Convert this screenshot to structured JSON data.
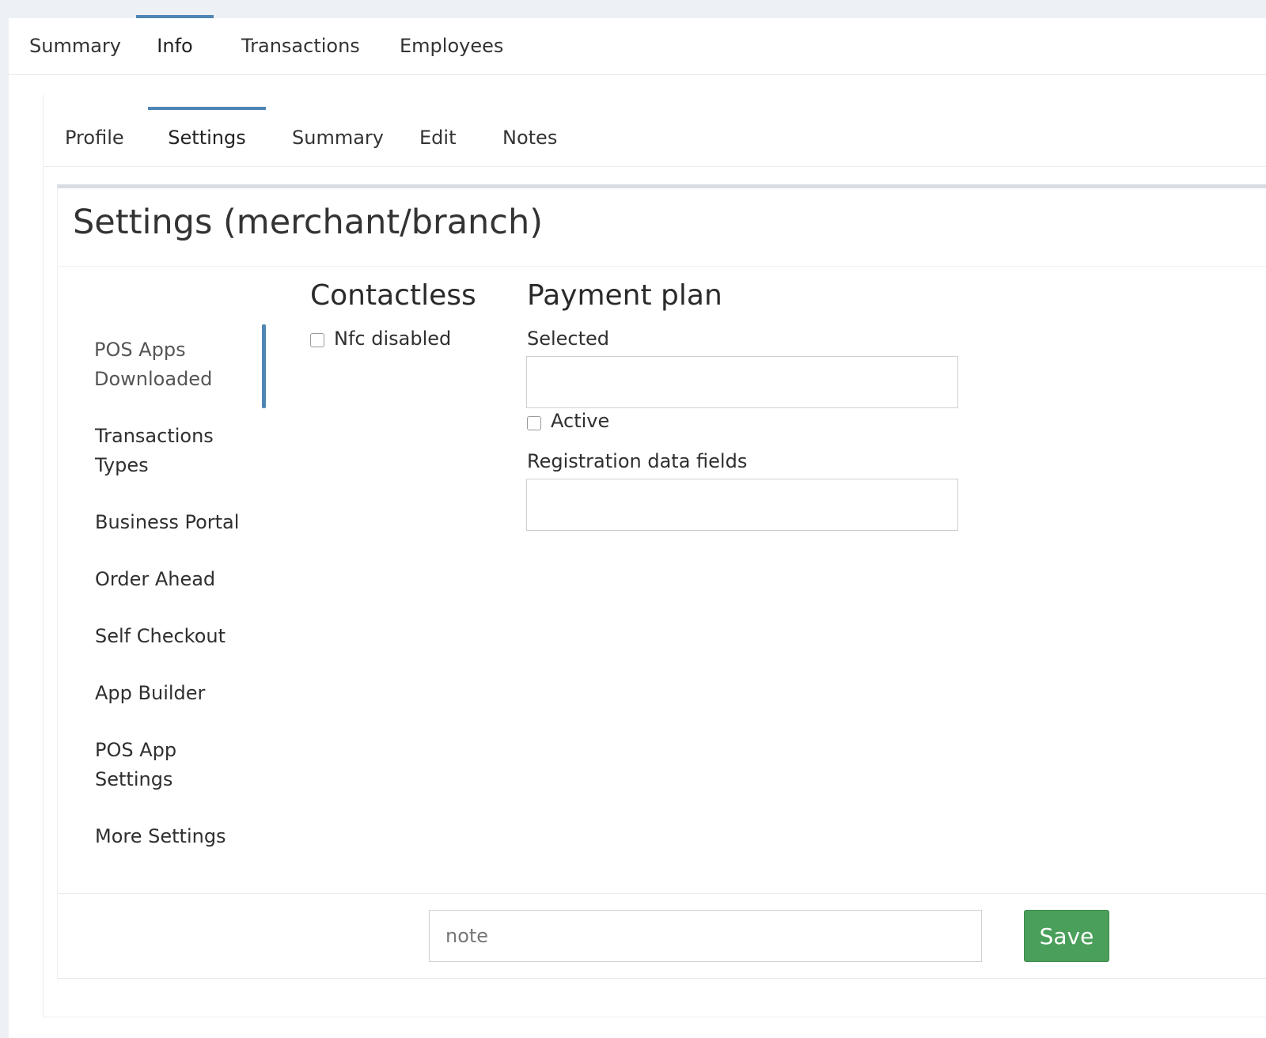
{
  "top_tabs": [
    "Summary",
    "Info",
    "Transactions",
    "Employees"
  ],
  "top_active_tab": "Info",
  "sub_tabs": [
    "Profile",
    "Settings",
    "Summary",
    "Edit",
    "Notes"
  ],
  "sub_active_tab": "Settings",
  "panel": {
    "title": "Settings (merchant/branch)"
  },
  "side_nav": {
    "items": [
      "POS Apps Downloaded",
      "Transactions Types",
      "Business Portal",
      "Order Ahead",
      "Self Checkout",
      "App Builder",
      "POS App Settings",
      "More Settings"
    ],
    "active": "POS Apps Downloaded"
  },
  "contactless": {
    "title": "Contactless",
    "nfc_disabled_label": "Nfc disabled",
    "nfc_disabled_checked": false
  },
  "payment_plan": {
    "title": "Payment plan",
    "selected_label": "Selected",
    "selected_value": "",
    "active_label": "Active",
    "active_checked": false,
    "registration_label": "Registration data fields",
    "registration_value": ""
  },
  "footer": {
    "note_placeholder": "note",
    "save_label": "Save"
  },
  "colors": {
    "accent": "#4f86b5",
    "save_button": "#4a9f5a",
    "page_background": "#edf0f4"
  }
}
